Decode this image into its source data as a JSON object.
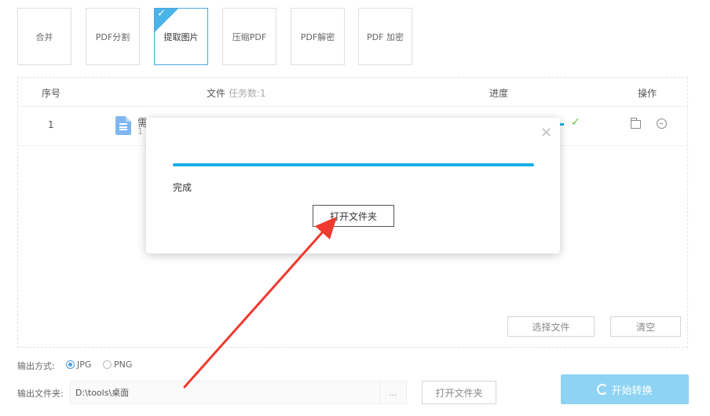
{
  "toolbar": {
    "tools": [
      {
        "label": "合并"
      },
      {
        "label": "PDF分割"
      },
      {
        "label": "提取图片"
      },
      {
        "label": "压缩PDF"
      },
      {
        "label": "PDF解密"
      },
      {
        "label": "PDF 加密"
      }
    ],
    "active_check": "✓"
  },
  "table": {
    "headers": {
      "index": "序号",
      "file": "文件",
      "task_count": "任务数:1",
      "progress": "进度",
      "action": "操作"
    },
    "rows": [
      {
        "index": "1",
        "name": "需",
        "size": "1",
        "progress_mark": "✓"
      }
    ],
    "select_file_label": "选择文件",
    "clear_label": "清空"
  },
  "output": {
    "format_label": "输出方式:",
    "formats": [
      {
        "label": "JPG",
        "selected": true
      },
      {
        "label": "PNG",
        "selected": false
      }
    ],
    "folder_label": "输出文件夹:",
    "folder_path": "D:\\tools\\桌面",
    "browse_label": "...",
    "open_folder_label": "打开文件夹",
    "start_label": "开始转换"
  },
  "modal": {
    "close_symbol": "×",
    "progress_percent": 100,
    "status": "完成",
    "open_folder_label": "打开文件夹"
  },
  "colors": {
    "accent": "#18aee5",
    "start_button": "#8fd3f4",
    "check_green": "#67c23a",
    "annotation_arrow": "#f03a2e"
  }
}
